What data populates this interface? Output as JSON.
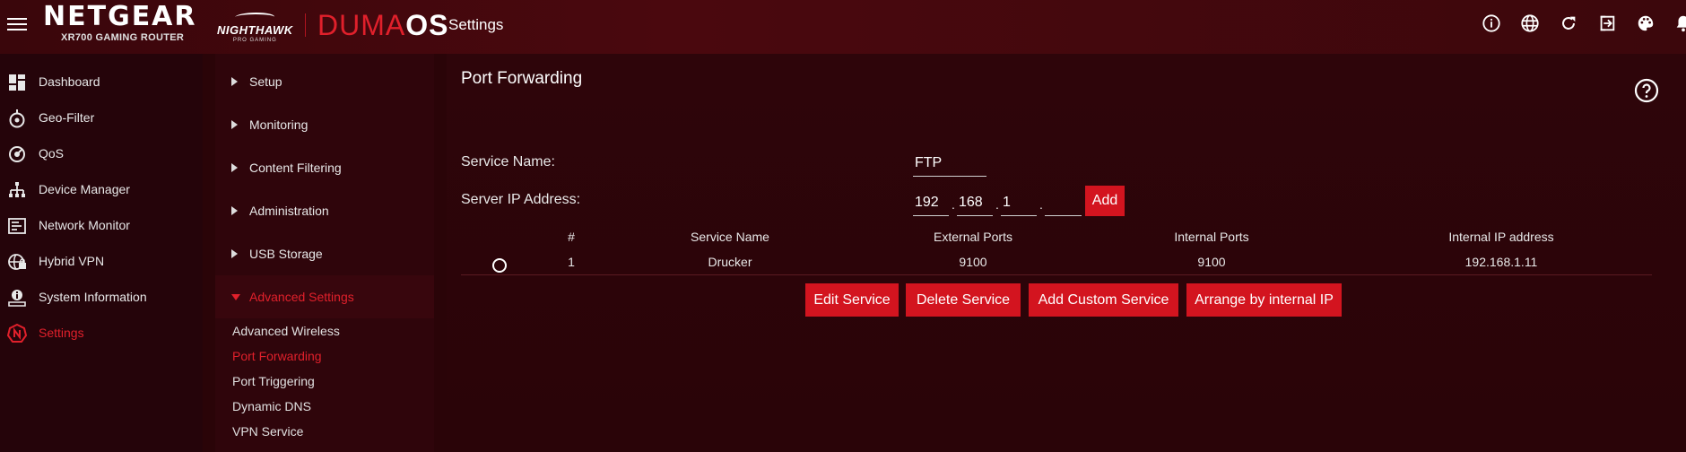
{
  "header": {
    "brand": "NETGEAR",
    "model": "XR700 GAMING ROUTER",
    "nighthawk": "NIGHTHAWK",
    "nighthawk_sub": "PRO GAMING",
    "duma": "DUMA",
    "os": "OS",
    "title": "Settings",
    "icons": [
      "info-icon",
      "globe-icon",
      "refresh-icon",
      "logout-icon",
      "palette-icon",
      "bell-icon"
    ]
  },
  "sidebar": {
    "items": [
      {
        "label": "Dashboard",
        "icon": "dashboard-icon"
      },
      {
        "label": "Geo-Filter",
        "icon": "geo-filter-icon"
      },
      {
        "label": "QoS",
        "icon": "qos-icon"
      },
      {
        "label": "Device Manager",
        "icon": "device-manager-icon"
      },
      {
        "label": "Network Monitor",
        "icon": "network-monitor-icon"
      },
      {
        "label": "Hybrid VPN",
        "icon": "hybrid-vpn-icon"
      },
      {
        "label": "System Information",
        "icon": "system-information-icon"
      },
      {
        "label": "Settings",
        "icon": "settings-icon"
      }
    ],
    "active": "Settings"
  },
  "subnav": {
    "items": [
      "Setup",
      "Monitoring",
      "Content Filtering",
      "Administration",
      "USB Storage",
      "Advanced Settings"
    ],
    "links": [
      "Advanced Wireless",
      "Port Forwarding",
      "Port Triggering",
      "Dynamic DNS",
      "VPN Service"
    ],
    "active_link": "Port Forwarding"
  },
  "main": {
    "title": "Port Forwarding",
    "service_name_label": "Service Name:",
    "service_name_value": "FTP",
    "server_ip_label": "Server IP Address:",
    "ip": [
      "192",
      "168",
      "1",
      ""
    ],
    "ip_separator": ".",
    "add_label": "Add",
    "table": {
      "headers": [
        "#",
        "Service Name",
        "External Ports",
        "Internal Ports",
        "Internal IP address"
      ],
      "rows": [
        {
          "index": "1",
          "service_name": "Drucker",
          "external_ports": "9100",
          "internal_ports": "9100",
          "internal_ip": "192.168.1.11"
        }
      ]
    },
    "buttons": {
      "edit": "Edit Service",
      "delete": "Delete Service",
      "add_custom": "Add Custom Service",
      "arrange": "Arrange by internal IP"
    }
  },
  "colors": {
    "accent": "#d3141f",
    "active_text": "#e0202b",
    "background": "#2a0408"
  }
}
